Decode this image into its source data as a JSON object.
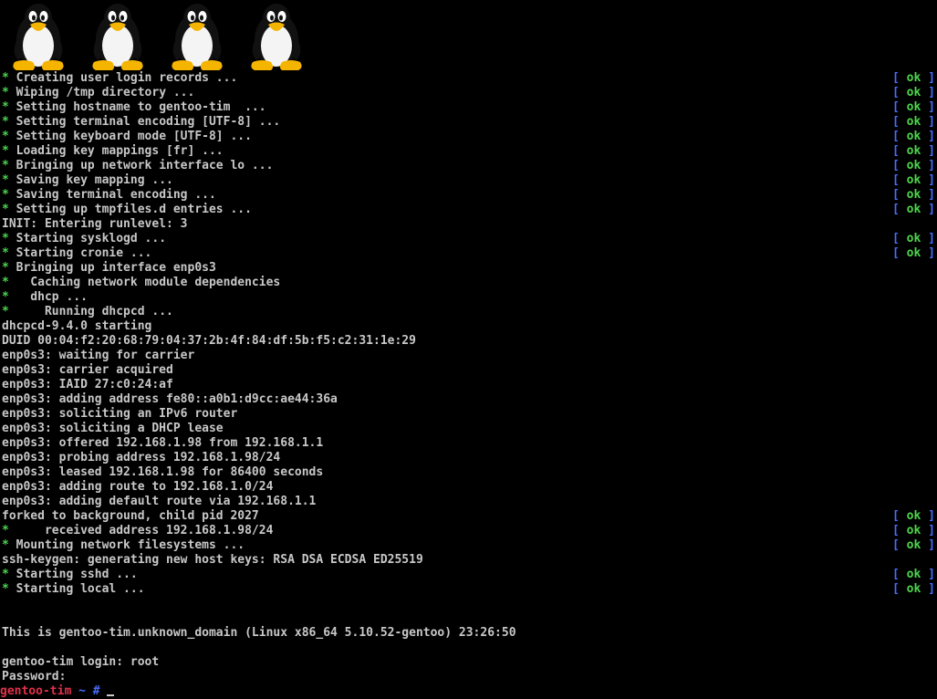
{
  "logo": {
    "icon": "tux-penguin-icon",
    "count": 4
  },
  "colors": {
    "background": "#000000",
    "text": "#c8c8c8",
    "star": "#4cd64c",
    "ok_bracket": "#4a6cff",
    "ok_word": "#4cd64c",
    "hostname": "#e0304a",
    "prompt_symbols": "#4a6cff"
  },
  "ok_status": {
    "open": "[ ",
    "word": "ok",
    "close": " ]"
  },
  "lines": [
    {
      "star": true,
      "text": " Creating user login records ...",
      "ok": true
    },
    {
      "star": true,
      "text": " Wiping /tmp directory ...",
      "ok": true
    },
    {
      "star": true,
      "text": " Setting hostname to gentoo-tim  ...",
      "ok": true
    },
    {
      "star": true,
      "text": " Setting terminal encoding [UTF-8] ...",
      "ok": true
    },
    {
      "star": true,
      "text": " Setting keyboard mode [UTF-8] ...",
      "ok": true
    },
    {
      "star": true,
      "text": " Loading key mappings [fr] ...",
      "ok": true
    },
    {
      "star": true,
      "text": " Bringing up network interface lo ...",
      "ok": true
    },
    {
      "star": true,
      "text": " Saving key mapping ...",
      "ok": true
    },
    {
      "star": true,
      "text": " Saving terminal encoding ...",
      "ok": true
    },
    {
      "star": true,
      "text": " Setting up tmpfiles.d entries ...",
      "ok": true
    },
    {
      "star": false,
      "text": "INIT: Entering runlevel: 3",
      "ok": false
    },
    {
      "star": true,
      "text": " Starting sysklogd ...",
      "ok": true
    },
    {
      "star": true,
      "text": " Starting cronie ...",
      "ok": true
    },
    {
      "star": true,
      "text": " Bringing up interface enp0s3",
      "ok": false
    },
    {
      "star": true,
      "text": "   Caching network module dependencies",
      "ok": false
    },
    {
      "star": true,
      "text": "   dhcp ...",
      "ok": false
    },
    {
      "star": true,
      "text": "     Running dhcpcd ...",
      "ok": false
    },
    {
      "star": false,
      "text": "dhcpcd-9.4.0 starting",
      "ok": false
    },
    {
      "star": false,
      "text": "DUID 00:04:f2:20:68:79:04:37:2b:4f:84:df:5b:f5:c2:31:1e:29",
      "ok": false
    },
    {
      "star": false,
      "text": "enp0s3: waiting for carrier",
      "ok": false
    },
    {
      "star": false,
      "text": "enp0s3: carrier acquired",
      "ok": false
    },
    {
      "star": false,
      "text": "enp0s3: IAID 27:c0:24:af",
      "ok": false
    },
    {
      "star": false,
      "text": "enp0s3: adding address fe80::a0b1:d9cc:ae44:36a",
      "ok": false
    },
    {
      "star": false,
      "text": "enp0s3: soliciting an IPv6 router",
      "ok": false
    },
    {
      "star": false,
      "text": "enp0s3: soliciting a DHCP lease",
      "ok": false
    },
    {
      "star": false,
      "text": "enp0s3: offered 192.168.1.98 from 192.168.1.1",
      "ok": false
    },
    {
      "star": false,
      "text": "enp0s3: probing address 192.168.1.98/24",
      "ok": false
    },
    {
      "star": false,
      "text": "enp0s3: leased 192.168.1.98 for 86400 seconds",
      "ok": false
    },
    {
      "star": false,
      "text": "enp0s3: adding route to 192.168.1.0/24",
      "ok": false
    },
    {
      "star": false,
      "text": "enp0s3: adding default route via 192.168.1.1",
      "ok": false
    },
    {
      "star": false,
      "text": "forked to background, child pid 2027",
      "ok": true
    },
    {
      "star": true,
      "text": "     received address 192.168.1.98/24",
      "ok": true
    },
    {
      "star": true,
      "text": " Mounting network filesystems ...",
      "ok": true
    },
    {
      "star": false,
      "text": "ssh-keygen: generating new host keys: RSA DSA ECDSA ED25519",
      "ok": false
    },
    {
      "star": true,
      "text": " Starting sshd ...",
      "ok": true
    },
    {
      "star": true,
      "text": " Starting local ...",
      "ok": true
    },
    {
      "star": false,
      "text": "",
      "ok": false
    },
    {
      "star": false,
      "text": "",
      "ok": false
    },
    {
      "star": false,
      "text": "This is gentoo-tim.unknown_domain (Linux x86_64 5.10.52-gentoo) 23:26:50",
      "ok": false
    },
    {
      "star": false,
      "text": "",
      "ok": false
    },
    {
      "star": false,
      "text": "gentoo-tim login: root",
      "ok": false
    },
    {
      "star": false,
      "text": "Password:",
      "ok": false
    }
  ],
  "prompt": {
    "hostname": "gentoo-tim",
    "path": " ~ ",
    "symbol": "#",
    "input": " "
  }
}
